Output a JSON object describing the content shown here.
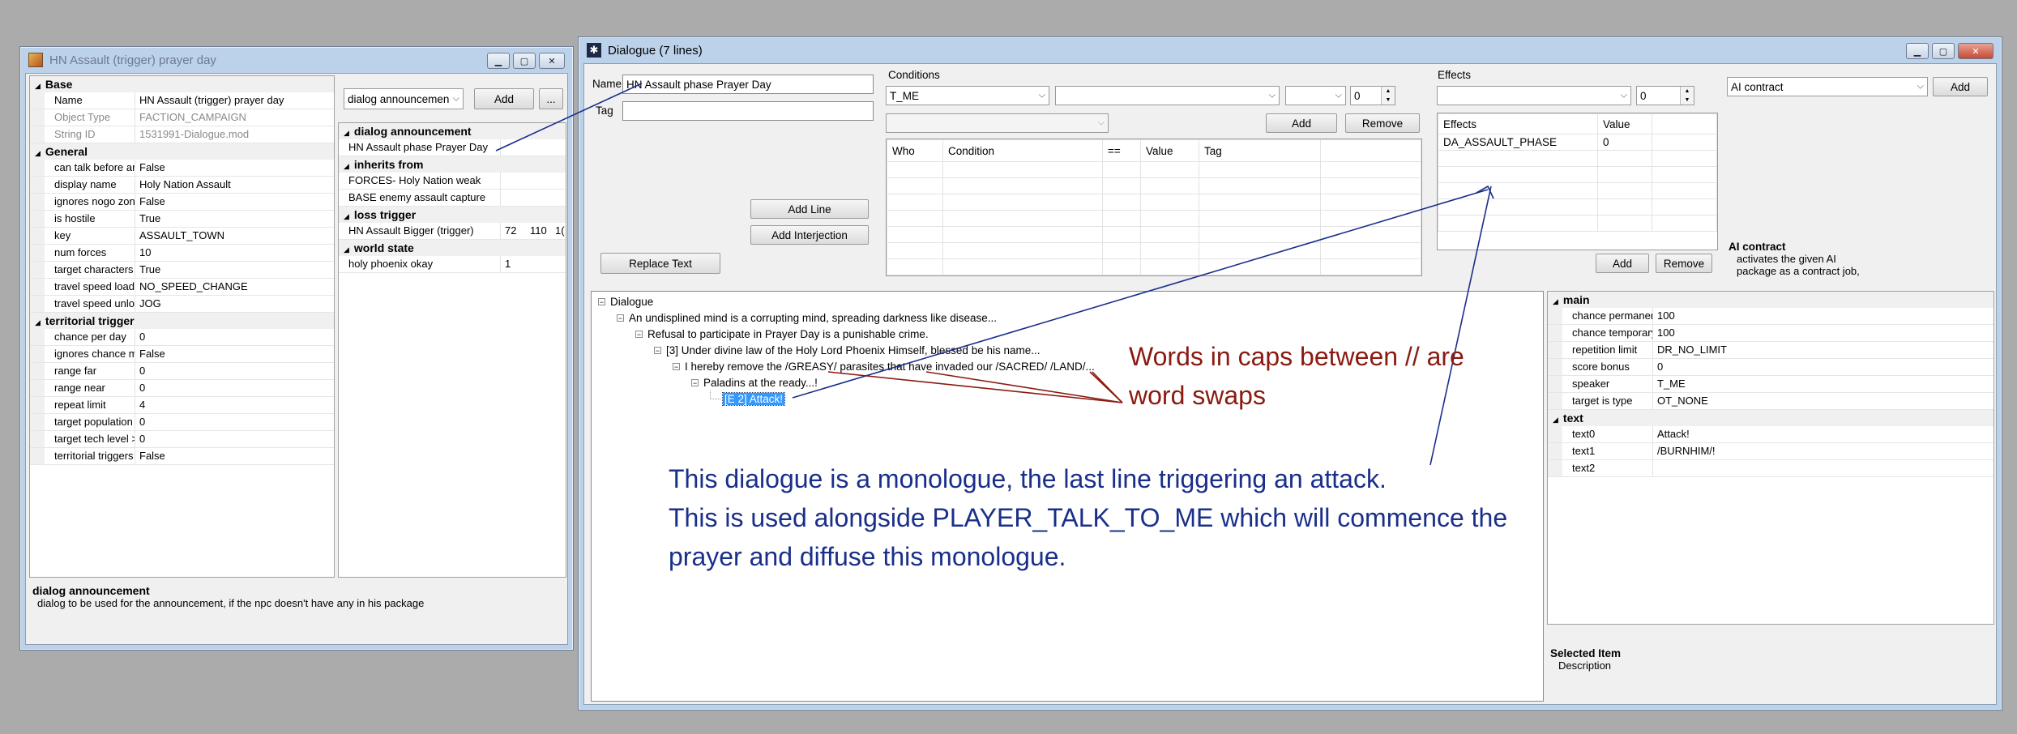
{
  "left_window": {
    "title": "HN Assault (trigger) prayer day",
    "categories": [
      {
        "name": "Base",
        "rows": [
          {
            "key": "Name",
            "value": "HN Assault (trigger) prayer day",
            "disabled": false
          },
          {
            "key": "Object Type",
            "value": "FACTION_CAMPAIGN",
            "disabled": true
          },
          {
            "key": "String ID",
            "value": "1531991-Dialogue.mod",
            "disabled": true
          }
        ]
      },
      {
        "name": "General",
        "rows": [
          {
            "key": "can talk before arrival",
            "value": "False"
          },
          {
            "key": "display name",
            "value": "Holy Nation Assault"
          },
          {
            "key": "ignores nogo zones",
            "value": "False"
          },
          {
            "key": "is hostile",
            "value": "True"
          },
          {
            "key": "key",
            "value": "ASSAULT_TOWN"
          },
          {
            "key": "num forces",
            "value": "10"
          },
          {
            "key": "target characters",
            "value": "True"
          },
          {
            "key": "travel speed loaded",
            "value": "NO_SPEED_CHANGE"
          },
          {
            "key": "travel speed unloaded",
            "value": "JOG"
          }
        ]
      },
      {
        "name": "territorial trigger",
        "rows": [
          {
            "key": "chance per day",
            "value": "0"
          },
          {
            "key": "ignores chance mults",
            "value": "False"
          },
          {
            "key": "range far",
            "value": "0"
          },
          {
            "key": "range near",
            "value": "0"
          },
          {
            "key": "repeat limit",
            "value": "4"
          },
          {
            "key": "target population min",
            "value": "0"
          },
          {
            "key": "target tech level >=",
            "value": "0"
          },
          {
            "key": "territorial triggers",
            "value": "False"
          }
        ]
      }
    ],
    "ref_combo": "dialog announcemen",
    "add_label": "Add",
    "more_label": "...",
    "refs": [
      {
        "name": "dialog announcement",
        "rows": [
          {
            "key": "HN Assault phase Prayer Day",
            "vals": []
          }
        ]
      },
      {
        "name": "inherits from",
        "rows": [
          {
            "key": "FORCES- Holy Nation weak",
            "vals": []
          },
          {
            "key": "BASE enemy assault capture",
            "vals": []
          }
        ]
      },
      {
        "name": "loss trigger",
        "rows": [
          {
            "key": "HN Assault Bigger (trigger)",
            "vals": [
              "72",
              "110",
              "1("
            ]
          }
        ]
      },
      {
        "name": "world state",
        "rows": [
          {
            "key": "holy phoenix okay",
            "vals": [
              "1"
            ]
          }
        ]
      }
    ],
    "help_title": "dialog announcement",
    "help_desc": "dialog to be used for the announcement, if the npc doesn't have any in his package"
  },
  "right_window": {
    "title": "Dialogue (7 lines)",
    "name_label": "Name",
    "name_value": "HN Assault phase Prayer Day",
    "tag_label": "Tag",
    "tag_value": "",
    "add_line": "Add Line",
    "add_interjection": "Add Interjection",
    "replace_text": "Replace Text",
    "conditions": {
      "label": "Conditions",
      "combo1": "T_ME",
      "combo2": "",
      "combo3": "",
      "spin": "0",
      "combo4": "",
      "add": "Add",
      "remove": "Remove",
      "headers": [
        "Who",
        "Condition",
        "==",
        "Value",
        "Tag"
      ]
    },
    "effects": {
      "label": "Effects",
      "combo": "",
      "spin": "0",
      "headers": [
        "Effects",
        "Value"
      ],
      "rows": [
        [
          "DA_ASSAULT_PHASE",
          "0"
        ]
      ],
      "add": "Add",
      "remove": "Remove"
    },
    "ai": {
      "combo": "AI contract",
      "add": "Add",
      "help_title": "AI contract",
      "help_desc1": "activates the given AI",
      "help_desc2": "package as a contract job,"
    },
    "tree": [
      {
        "text": "Dialogue",
        "selected": false
      },
      {
        "text": "An undisplined mind is a corrupting mind, spreading darkness like disease...",
        "selected": false
      },
      {
        "text": "Refusal to participate in Prayer Day is a punishable crime.",
        "selected": false
      },
      {
        "text": "[3] Under divine law of the Holy Lord Phoenix Himself, blessed be his name...",
        "selected": false
      },
      {
        "text": "I hereby remove the /GREASY/ parasites that have invaded our /SACRED/ /LAND/...",
        "selected": false
      },
      {
        "text": "Paladins at the ready...!",
        "selected": false
      },
      {
        "text": "[E 2] Attack!",
        "selected": true
      }
    ],
    "props": [
      {
        "name": "main",
        "rows": [
          {
            "key": "chance permanent",
            "value": "100"
          },
          {
            "key": "chance temporary",
            "value": "100"
          },
          {
            "key": "repetition limit",
            "value": "DR_NO_LIMIT"
          },
          {
            "key": "score bonus",
            "value": "0"
          },
          {
            "key": "speaker",
            "value": "T_ME"
          },
          {
            "key": "target is type",
            "value": "OT_NONE"
          }
        ]
      },
      {
        "name": "text",
        "rows": [
          {
            "key": "text0",
            "value": "Attack!"
          },
          {
            "key": "text1",
            "value": "/BURNHIM/!"
          },
          {
            "key": "text2",
            "value": ""
          }
        ]
      }
    ],
    "sel_title": "Selected Item",
    "sel_desc": "Description"
  },
  "annotations": {
    "red_line1": "Words in caps between // are",
    "red_line2": "word swaps",
    "blue_line1": "This dialogue is a monologue, the last line triggering an attack.",
    "blue_line2": "This is used alongside PLAYER_TALK_TO_ME which will commence the",
    "blue_line3": "prayer and diffuse this monologue."
  },
  "colors": {
    "annotation_red": "#8b1a10",
    "annotation_blue": "#1a2f8a",
    "selection": "#3399ff"
  }
}
